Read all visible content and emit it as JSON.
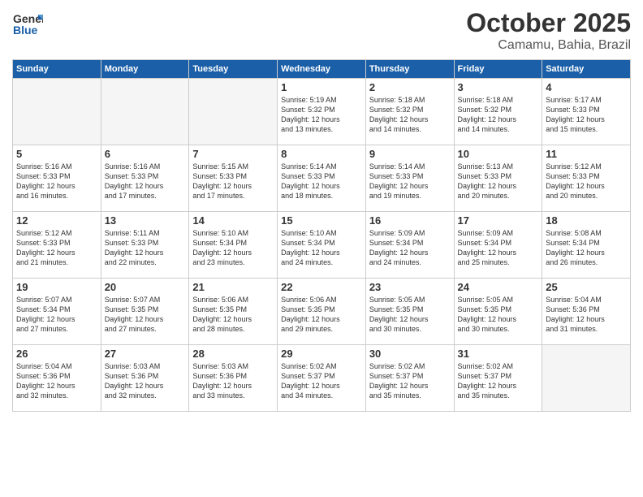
{
  "logo": {
    "line1": "General",
    "line2": "Blue"
  },
  "header": {
    "month": "October 2025",
    "location": "Camamu, Bahia, Brazil"
  },
  "days_of_week": [
    "Sunday",
    "Monday",
    "Tuesday",
    "Wednesday",
    "Thursday",
    "Friday",
    "Saturday"
  ],
  "weeks": [
    [
      {
        "day": "",
        "info": ""
      },
      {
        "day": "",
        "info": ""
      },
      {
        "day": "",
        "info": ""
      },
      {
        "day": "1",
        "info": "Sunrise: 5:19 AM\nSunset: 5:32 PM\nDaylight: 12 hours\nand 13 minutes."
      },
      {
        "day": "2",
        "info": "Sunrise: 5:18 AM\nSunset: 5:32 PM\nDaylight: 12 hours\nand 14 minutes."
      },
      {
        "day": "3",
        "info": "Sunrise: 5:18 AM\nSunset: 5:32 PM\nDaylight: 12 hours\nand 14 minutes."
      },
      {
        "day": "4",
        "info": "Sunrise: 5:17 AM\nSunset: 5:33 PM\nDaylight: 12 hours\nand 15 minutes."
      }
    ],
    [
      {
        "day": "5",
        "info": "Sunrise: 5:16 AM\nSunset: 5:33 PM\nDaylight: 12 hours\nand 16 minutes."
      },
      {
        "day": "6",
        "info": "Sunrise: 5:16 AM\nSunset: 5:33 PM\nDaylight: 12 hours\nand 17 minutes."
      },
      {
        "day": "7",
        "info": "Sunrise: 5:15 AM\nSunset: 5:33 PM\nDaylight: 12 hours\nand 17 minutes."
      },
      {
        "day": "8",
        "info": "Sunrise: 5:14 AM\nSunset: 5:33 PM\nDaylight: 12 hours\nand 18 minutes."
      },
      {
        "day": "9",
        "info": "Sunrise: 5:14 AM\nSunset: 5:33 PM\nDaylight: 12 hours\nand 19 minutes."
      },
      {
        "day": "10",
        "info": "Sunrise: 5:13 AM\nSunset: 5:33 PM\nDaylight: 12 hours\nand 20 minutes."
      },
      {
        "day": "11",
        "info": "Sunrise: 5:12 AM\nSunset: 5:33 PM\nDaylight: 12 hours\nand 20 minutes."
      }
    ],
    [
      {
        "day": "12",
        "info": "Sunrise: 5:12 AM\nSunset: 5:33 PM\nDaylight: 12 hours\nand 21 minutes."
      },
      {
        "day": "13",
        "info": "Sunrise: 5:11 AM\nSunset: 5:33 PM\nDaylight: 12 hours\nand 22 minutes."
      },
      {
        "day": "14",
        "info": "Sunrise: 5:10 AM\nSunset: 5:34 PM\nDaylight: 12 hours\nand 23 minutes."
      },
      {
        "day": "15",
        "info": "Sunrise: 5:10 AM\nSunset: 5:34 PM\nDaylight: 12 hours\nand 24 minutes."
      },
      {
        "day": "16",
        "info": "Sunrise: 5:09 AM\nSunset: 5:34 PM\nDaylight: 12 hours\nand 24 minutes."
      },
      {
        "day": "17",
        "info": "Sunrise: 5:09 AM\nSunset: 5:34 PM\nDaylight: 12 hours\nand 25 minutes."
      },
      {
        "day": "18",
        "info": "Sunrise: 5:08 AM\nSunset: 5:34 PM\nDaylight: 12 hours\nand 26 minutes."
      }
    ],
    [
      {
        "day": "19",
        "info": "Sunrise: 5:07 AM\nSunset: 5:34 PM\nDaylight: 12 hours\nand 27 minutes."
      },
      {
        "day": "20",
        "info": "Sunrise: 5:07 AM\nSunset: 5:35 PM\nDaylight: 12 hours\nand 27 minutes."
      },
      {
        "day": "21",
        "info": "Sunrise: 5:06 AM\nSunset: 5:35 PM\nDaylight: 12 hours\nand 28 minutes."
      },
      {
        "day": "22",
        "info": "Sunrise: 5:06 AM\nSunset: 5:35 PM\nDaylight: 12 hours\nand 29 minutes."
      },
      {
        "day": "23",
        "info": "Sunrise: 5:05 AM\nSunset: 5:35 PM\nDaylight: 12 hours\nand 30 minutes."
      },
      {
        "day": "24",
        "info": "Sunrise: 5:05 AM\nSunset: 5:35 PM\nDaylight: 12 hours\nand 30 minutes."
      },
      {
        "day": "25",
        "info": "Sunrise: 5:04 AM\nSunset: 5:36 PM\nDaylight: 12 hours\nand 31 minutes."
      }
    ],
    [
      {
        "day": "26",
        "info": "Sunrise: 5:04 AM\nSunset: 5:36 PM\nDaylight: 12 hours\nand 32 minutes."
      },
      {
        "day": "27",
        "info": "Sunrise: 5:03 AM\nSunset: 5:36 PM\nDaylight: 12 hours\nand 32 minutes."
      },
      {
        "day": "28",
        "info": "Sunrise: 5:03 AM\nSunset: 5:36 PM\nDaylight: 12 hours\nand 33 minutes."
      },
      {
        "day": "29",
        "info": "Sunrise: 5:02 AM\nSunset: 5:37 PM\nDaylight: 12 hours\nand 34 minutes."
      },
      {
        "day": "30",
        "info": "Sunrise: 5:02 AM\nSunset: 5:37 PM\nDaylight: 12 hours\nand 35 minutes."
      },
      {
        "day": "31",
        "info": "Sunrise: 5:02 AM\nSunset: 5:37 PM\nDaylight: 12 hours\nand 35 minutes."
      },
      {
        "day": "",
        "info": ""
      }
    ]
  ]
}
